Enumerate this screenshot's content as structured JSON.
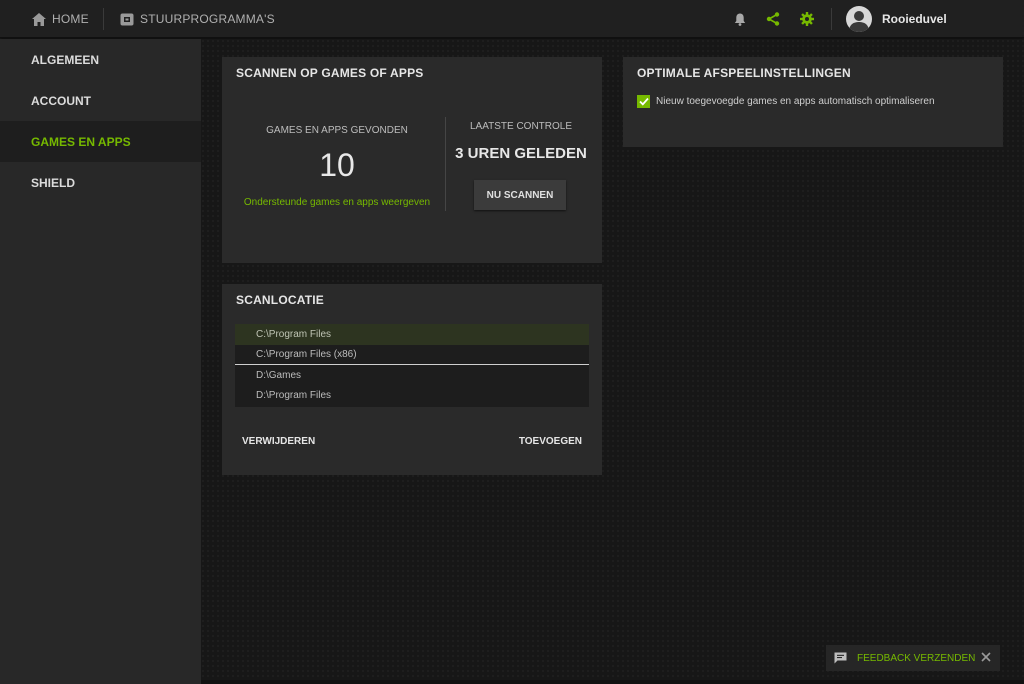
{
  "topbar": {
    "home_label": "HOME",
    "drivers_label": "STUURPROGRAMMA'S",
    "username": "Rooieduvel",
    "accent_color": "#76b900"
  },
  "sidebar": {
    "items": [
      {
        "label": "ALGEMEEN",
        "active": false
      },
      {
        "label": "ACCOUNT",
        "active": false
      },
      {
        "label": "GAMES EN APPS",
        "active": true
      },
      {
        "label": "SHIELD",
        "active": false
      }
    ]
  },
  "scan_panel": {
    "title": "SCANNEN OP GAMES OF APPS",
    "found_label": "GAMES EN APPS GEVONDEN",
    "found_count": "10",
    "show_link": "Ondersteunde games en apps weergeven",
    "last_check_label": "LAATSTE CONTROLE",
    "last_check_value": "3 UREN GELEDEN",
    "scan_button": "NU SCANNEN"
  },
  "optimal_panel": {
    "title": "OPTIMALE AFSPEELINSTELLINGEN",
    "checkbox_label": "Nieuw toegevoegde games en apps automatisch optimaliseren",
    "checked": true
  },
  "scan_location_panel": {
    "title": "SCANLOCATIE",
    "locations": [
      "C:\\Program Files",
      "C:\\Program Files (x86)",
      "D:\\Games",
      "D:\\Program Files"
    ],
    "remove_label": "VERWIJDEREN",
    "add_label": "TOEVOEGEN"
  },
  "feedback": {
    "label": "FEEDBACK VERZENDEN"
  }
}
